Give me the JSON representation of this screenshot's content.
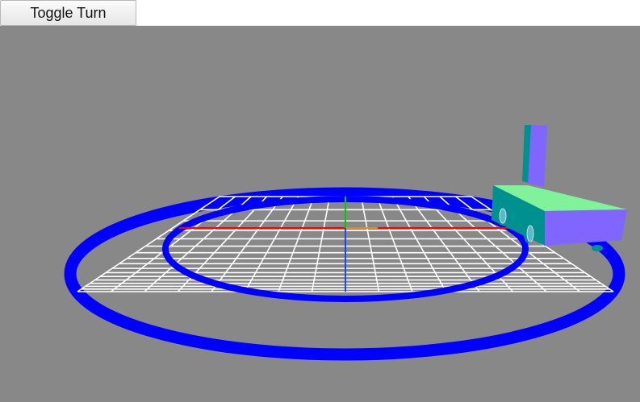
{
  "toolbar": {
    "toggle_turn_label": "Toggle Turn"
  },
  "scene": {
    "background_color": "#888888",
    "track_color": "#0000ff",
    "grid_color": "#ffffff",
    "axis_x_color": "#ff0000",
    "axis_y_color": "#00cc00",
    "axis_z_color": "#2244ff",
    "vehicle": {
      "body_top_color": "#80f29a",
      "body_front_color": "#8066ff",
      "body_side_color": "#009090",
      "mast_front_color": "#8066ff",
      "mast_side_color": "#009090",
      "wheel_color": "#009090"
    }
  }
}
